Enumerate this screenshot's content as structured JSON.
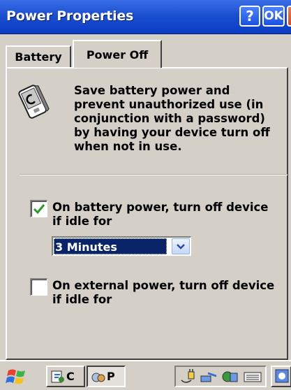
{
  "window": {
    "title": "Power Properties",
    "help_label": "?",
    "ok_label": "OK",
    "close_label": "✕"
  },
  "tabs": [
    {
      "label": "Battery",
      "active": false
    },
    {
      "label": "Power Off",
      "active": true
    }
  ],
  "panel": {
    "icon": "device-icon",
    "description": "Save battery power and prevent unauthorized use (in conjunction with a password) by having your device turn off when not in use.",
    "battery_option": {
      "label": "On battery power, turn off device if idle for",
      "checked": true
    },
    "battery_timeout": {
      "selected": "3 Minutes"
    },
    "external_option": {
      "label": "On external power, turn off device if idle for",
      "checked": false
    }
  },
  "taskbar": {
    "start_icon": "windows-flag-icon",
    "buttons": [
      {
        "label": "C",
        "icon": "control-panel-icon"
      },
      {
        "label": "P",
        "icon": "power-icon",
        "active": true
      }
    ],
    "tray_icons": [
      "power-plug-icon",
      "network-icon",
      "connectivity-icon",
      "keyboard-icon"
    ],
    "desktop_icon": "desktop-icon"
  },
  "colors": {
    "title_bar": "#1b4fd0",
    "selection": "#0a246a",
    "checkmark": "#2a9a2a",
    "dialog_bg": "#d4d0c8"
  }
}
